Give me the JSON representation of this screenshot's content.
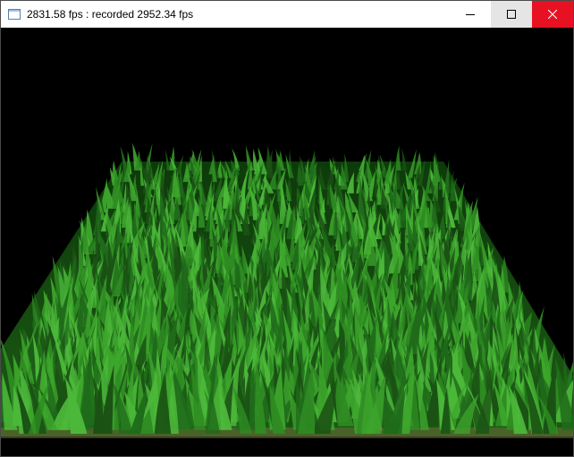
{
  "window": {
    "title": "2831.58 fps : recorded 2952.34 fps",
    "app_icon": "window-icon",
    "controls": {
      "minimize_icon": "minimize-icon",
      "maximize_icon": "maximize-icon",
      "close_icon": "close-icon",
      "close_hover_color": "#e81123"
    }
  },
  "scene": {
    "subject": "grass-field",
    "background_color": "#000000",
    "grass_colors": [
      "#1f6b1a",
      "#2e8b22",
      "#3da52c",
      "#1a5214",
      "#4cb83a"
    ]
  }
}
